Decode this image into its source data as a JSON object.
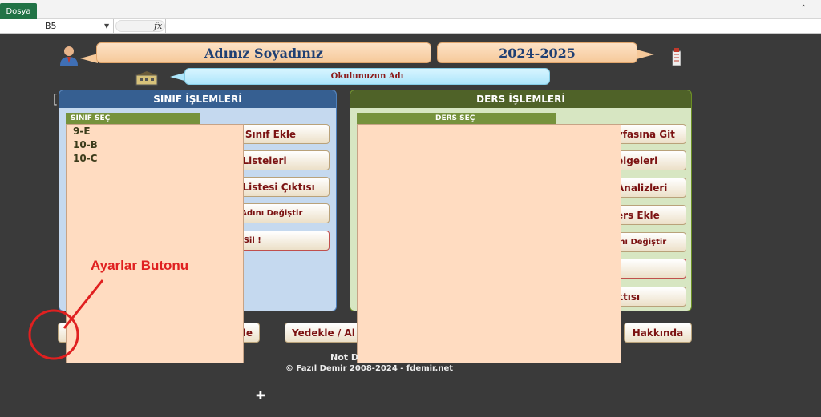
{
  "excel": {
    "file_tab": "Dosya",
    "name_box": "B5",
    "fx": "fx"
  },
  "header": {
    "name": "Adınız Soyadınız",
    "year": "2024-2025",
    "school": "Okulunuzun Adı"
  },
  "left_panel": {
    "title": "SINIF İŞLEMLERİ",
    "select_label": "SINIF SEÇ",
    "classes": [
      "9-E",
      "10-B",
      "10-C"
    ],
    "buttons": [
      "ni Sınıf Ekle",
      "ıf Listeleri",
      "ıf Listesi Çıktısı",
      "ıf Adını Değiştir",
      "ıfı Sil !"
    ]
  },
  "right_panel": {
    "title": "DERS İŞLEMLERİ",
    "select_label": "DERS SEÇ",
    "buttons": [
      "yfasına Git",
      "elgeleri",
      "Analizleri",
      "ers Ekle",
      "ını Değiştir",
      "!",
      "ktısı"
    ]
  },
  "bottom": {
    "backup_button": "Yedekle / Al",
    "left_partial_button": "le",
    "about_button": "Hakkında",
    "footer_partial": "Not D",
    "copyright": "© Fazıl Demir 2008-2024 - fdemir.net"
  },
  "annotation": {
    "label": "Ayarlar Butonu",
    "color": "#e02020"
  }
}
